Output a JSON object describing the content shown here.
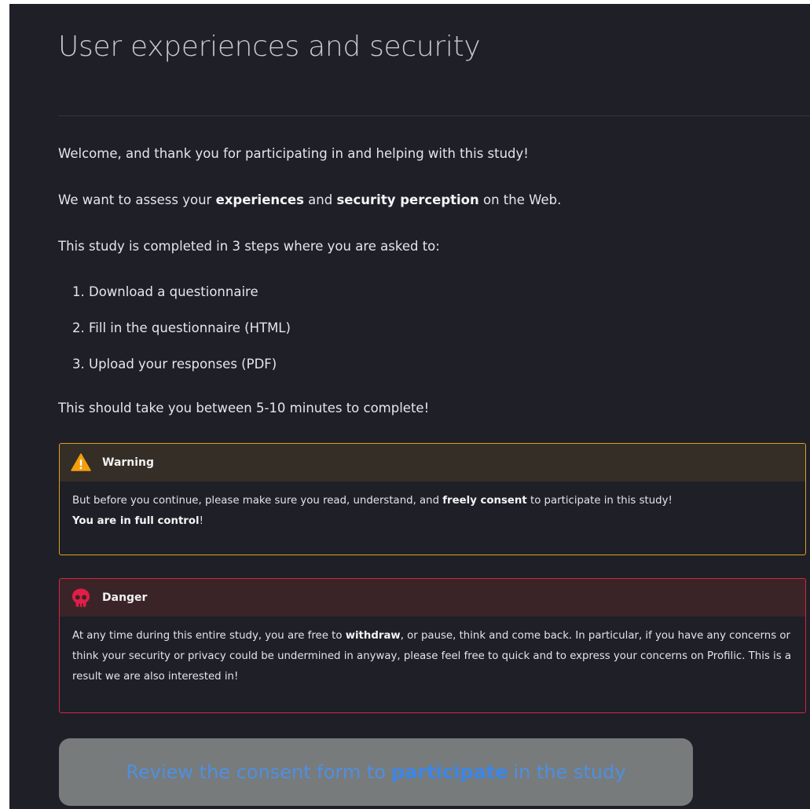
{
  "header": {
    "title": "User experiences and security"
  },
  "intro": {
    "welcome": "Welcome, and thank you for participating in and helping with this study!",
    "assess_prefix": "We want to assess your ",
    "assess_bold1": "experiences",
    "assess_mid": " and ",
    "assess_bold2": "security perception",
    "assess_suffix": " on the Web.",
    "steps_intro": "This study is completed in 3 steps where you are asked to:",
    "steps": [
      "1. Download a questionnaire",
      "2. Fill in the questionnaire (HTML)",
      "3. Upload your responses (PDF)"
    ],
    "duration": "This should take you between 5-10 minutes to complete!"
  },
  "warning": {
    "title": "Warning",
    "body_prefix": "But before you continue, please make sure you read, understand, and ",
    "body_bold": "freely consent",
    "body_suffix": " to participate in this study!",
    "body2_bold": "You are in full control",
    "body2_suffix": "!",
    "icon": "warning-triangle-icon",
    "color": "#f59e0b"
  },
  "danger": {
    "title": "Danger",
    "body_prefix": "At any time during this entire study, you are free to ",
    "body_bold": "withdraw",
    "body_suffix": ", or pause, think and come back. In particular, if you have any concerns or think your security or privacy could be undermined in anyway, please feel free to quick and to express your concerns on Profilic. This is a result we are also interested in!",
    "icon": "skull-icon",
    "color": "#e11d48"
  },
  "cta": {
    "prefix": "Review the consent form to ",
    "bold": "participate",
    "suffix": " in the study"
  }
}
